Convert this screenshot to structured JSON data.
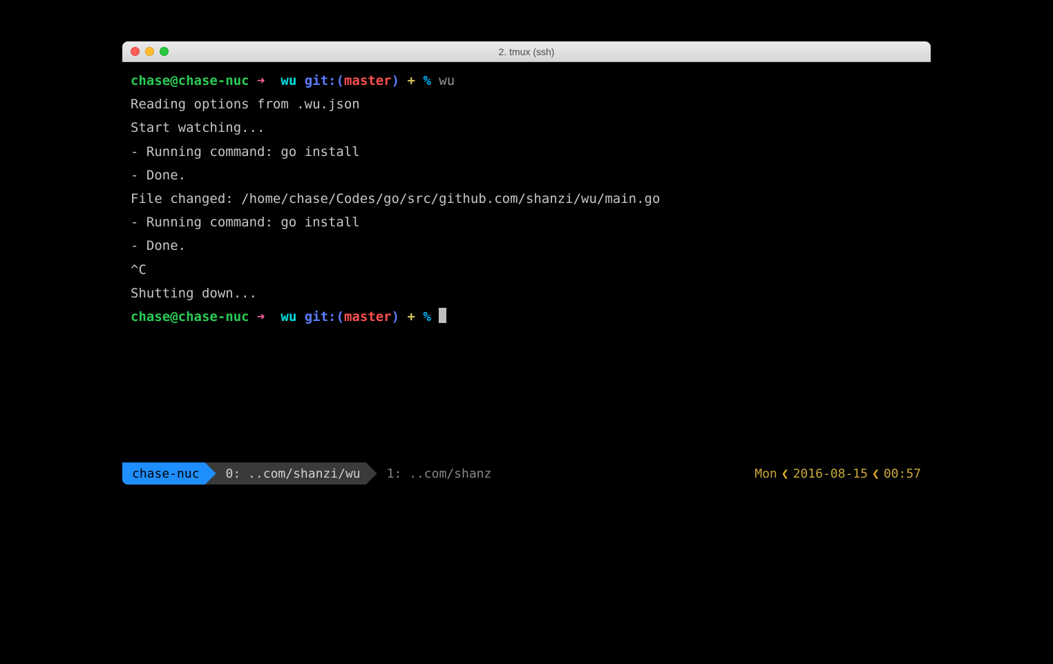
{
  "window": {
    "title": "2. tmux (ssh)"
  },
  "prompt": {
    "user_host": "chase@chase-nuc",
    "arrow": "➜",
    "dir": "wu",
    "git_label": "git:(",
    "branch": "master",
    "git_close": ")",
    "plus": "+",
    "pct": "%"
  },
  "cmd1": "wu",
  "output": {
    "l1": "Reading options from .wu.json",
    "l2": "Start watching...",
    "l3": "- Running command: go install",
    "l4": "- Done.",
    "l5": "File changed: /home/chase/Codes/go/src/github.com/shanzi/wu/main.go",
    "l6": "- Running command: go install",
    "l7": "- Done.",
    "l8": "^C",
    "l9": "Shutting down..."
  },
  "status": {
    "host": "chase-nuc",
    "win0": "0: ..com/shanzi/wu",
    "win1": "1: ..com/shanz",
    "day": "Mon",
    "date": "2016-08-15",
    "time": "00:57"
  }
}
